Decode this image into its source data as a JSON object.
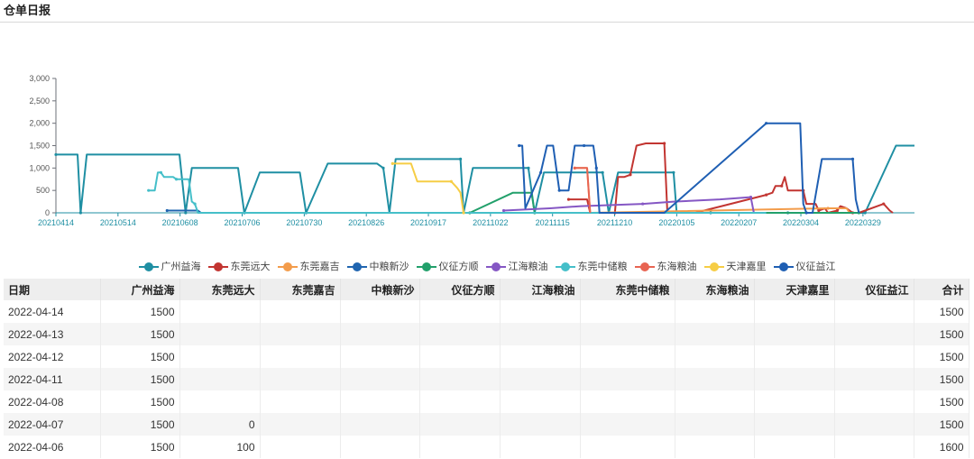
{
  "page": {
    "title": "仓单日报"
  },
  "chart_data": {
    "type": "line",
    "ylim": [
      0,
      3000
    ],
    "yticks": [
      0,
      500,
      1000,
      1500,
      2000,
      2500,
      3000
    ],
    "ytick_labels": [
      "0",
      "500",
      "1,000",
      "1,500",
      "2,000",
      "2,500",
      "3,000"
    ],
    "xticks": [
      "20210414",
      "20210514",
      "20210608",
      "20210706",
      "20210730",
      "20210826",
      "20210917",
      "20211022",
      "20211115",
      "20211210",
      "20220105",
      "20220207",
      "20220304",
      "20220329"
    ],
    "legend_position": "bottom",
    "series": [
      {
        "name": "广州益海",
        "color": "#1f8fa3",
        "points": [
          [
            0,
            1300
          ],
          [
            6,
            1300
          ],
          [
            7,
            1300
          ],
          [
            8,
            0
          ],
          [
            10,
            1300
          ],
          [
            40,
            1300
          ],
          [
            42,
            0
          ],
          [
            44,
            1000
          ],
          [
            59,
            1000
          ],
          [
            61,
            0
          ],
          [
            66,
            900
          ],
          [
            79,
            900
          ],
          [
            81,
            0
          ],
          [
            88,
            1100
          ],
          [
            104,
            1100
          ],
          [
            106,
            1000
          ],
          [
            108,
            0
          ],
          [
            110,
            1200
          ],
          [
            131,
            1200
          ],
          [
            132,
            0
          ],
          [
            135,
            1000
          ],
          [
            153,
            1000
          ],
          [
            155,
            0
          ],
          [
            158,
            900
          ],
          [
            177,
            900
          ],
          [
            179,
            0
          ],
          [
            182,
            900
          ],
          [
            200,
            900
          ],
          [
            201,
            0
          ],
          [
            209,
            0
          ],
          [
            212,
            0
          ],
          [
            222,
            0
          ],
          [
            224,
            0
          ],
          [
            237,
            0
          ],
          [
            239,
            0
          ],
          [
            260,
            0
          ],
          [
            262,
            0
          ],
          [
            272,
            1500
          ],
          [
            278,
            1500
          ]
        ]
      },
      {
        "name": "东莞远大",
        "color": "#c23531",
        "points": [
          [
            166,
            300
          ],
          [
            172,
            300
          ],
          [
            173,
            0
          ],
          [
            181,
            0
          ],
          [
            182,
            800
          ],
          [
            184,
            800
          ],
          [
            186,
            850
          ],
          [
            188,
            1500
          ],
          [
            191,
            1550
          ],
          [
            197,
            1550
          ],
          [
            198,
            0
          ],
          [
            207,
            0
          ],
          [
            230,
            400
          ],
          [
            232,
            450
          ],
          [
            233,
            600
          ],
          [
            235,
            600
          ],
          [
            236,
            800
          ],
          [
            237,
            500
          ],
          [
            242,
            500
          ],
          [
            243,
            200
          ],
          [
            246,
            200
          ],
          [
            247,
            50
          ],
          [
            249,
            100
          ],
          [
            250,
            0
          ],
          [
            253,
            50
          ],
          [
            254,
            150
          ],
          [
            256,
            100
          ],
          [
            258,
            0
          ],
          [
            260,
            0
          ],
          [
            266,
            150
          ],
          [
            268,
            200
          ],
          [
            270,
            50
          ],
          [
            271,
            0
          ]
        ]
      },
      {
        "name": "东莞嘉吉",
        "color": "#f39c4b",
        "points": [
          [
            168,
            1000
          ],
          [
            172,
            1000
          ],
          [
            173,
            0
          ],
          [
            250,
            100
          ],
          [
            256,
            100
          ],
          [
            257,
            0
          ]
        ]
      },
      {
        "name": "中粮新沙",
        "color": "#2065b0",
        "points": [
          [
            36,
            50
          ],
          [
            46,
            50
          ],
          [
            47,
            0
          ]
        ]
      },
      {
        "name": "仪征方顺",
        "color": "#22a06b",
        "points": [
          [
            134,
            0
          ],
          [
            148,
            450
          ],
          [
            154,
            450
          ],
          [
            155,
            0
          ],
          [
            170,
            0
          ],
          [
            230,
            0
          ],
          [
            260,
            0
          ]
        ]
      },
      {
        "name": "江海粮油",
        "color": "#8557c4",
        "points": [
          [
            145,
            50
          ],
          [
            160,
            100
          ],
          [
            170,
            150
          ],
          [
            190,
            200
          ],
          [
            200,
            250
          ],
          [
            215,
            300
          ],
          [
            225,
            350
          ],
          [
            226,
            0
          ]
        ]
      },
      {
        "name": "东莞中储粮",
        "color": "#45bfc9",
        "points": [
          [
            30,
            500
          ],
          [
            32,
            500
          ],
          [
            33,
            900
          ],
          [
            34,
            900
          ],
          [
            35,
            800
          ],
          [
            38,
            800
          ],
          [
            39,
            750
          ],
          [
            43,
            750
          ],
          [
            44,
            250
          ],
          [
            45,
            200
          ],
          [
            46,
            0
          ],
          [
            230,
            0
          ]
        ]
      },
      {
        "name": "东海粮油",
        "color": "#e86452",
        "points": [
          [
            168,
            1000
          ],
          [
            172,
            1000
          ],
          [
            173,
            0
          ]
        ]
      },
      {
        "name": "天津嘉里",
        "color": "#f6cd45",
        "points": [
          [
            109,
            1100
          ],
          [
            115,
            1100
          ],
          [
            117,
            700
          ],
          [
            128,
            700
          ],
          [
            130,
            550
          ],
          [
            131,
            450
          ],
          [
            132,
            0
          ]
        ]
      },
      {
        "name": "仪征益江",
        "color": "#1f5fb3",
        "points": [
          [
            150,
            1500
          ],
          [
            151,
            1500
          ],
          [
            152,
            100
          ],
          [
            157,
            900
          ],
          [
            159,
            1500
          ],
          [
            161,
            1500
          ],
          [
            163,
            500
          ],
          [
            166,
            500
          ],
          [
            168,
            1500
          ],
          [
            171,
            1500
          ],
          [
            173,
            1500
          ],
          [
            174,
            1500
          ],
          [
            175,
            1000
          ],
          [
            176,
            0
          ],
          [
            197,
            0
          ],
          [
            230,
            2000
          ],
          [
            241,
            2000
          ],
          [
            242,
            200
          ],
          [
            243,
            0
          ],
          [
            245,
            0
          ],
          [
            248,
            1200
          ],
          [
            258,
            1200
          ],
          [
            259,
            300
          ],
          [
            260,
            0
          ]
        ]
      }
    ]
  },
  "table": {
    "columns": [
      "日期",
      "广州益海",
      "东莞远大",
      "东莞嘉吉",
      "中粮新沙",
      "仪征方顺",
      "江海粮油",
      "东莞中储粮",
      "东海粮油",
      "天津嘉里",
      "仪征益江",
      "合计"
    ],
    "rows": [
      [
        "2022-04-14",
        "1500",
        "",
        "",
        "",
        "",
        "",
        "",
        "",
        "",
        "",
        "1500"
      ],
      [
        "2022-04-13",
        "1500",
        "",
        "",
        "",
        "",
        "",
        "",
        "",
        "",
        "",
        "1500"
      ],
      [
        "2022-04-12",
        "1500",
        "",
        "",
        "",
        "",
        "",
        "",
        "",
        "",
        "",
        "1500"
      ],
      [
        "2022-04-11",
        "1500",
        "",
        "",
        "",
        "",
        "",
        "",
        "",
        "",
        "",
        "1500"
      ],
      [
        "2022-04-08",
        "1500",
        "",
        "",
        "",
        "",
        "",
        "",
        "",
        "",
        "",
        "1500"
      ],
      [
        "2022-04-07",
        "1500",
        "0",
        "",
        "",
        "",
        "",
        "",
        "",
        "",
        "",
        "1500"
      ],
      [
        "2022-04-06",
        "1500",
        "100",
        "",
        "",
        "",
        "",
        "",
        "",
        "",
        "",
        "1600"
      ]
    ]
  }
}
